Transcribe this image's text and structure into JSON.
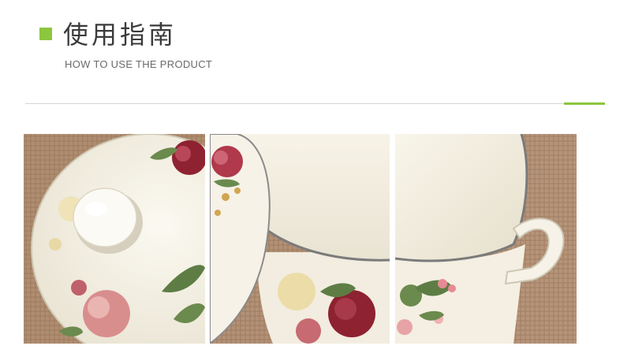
{
  "header": {
    "title": "使用指南",
    "subtitle": "HOW TO USE THE PRODUCT"
  },
  "colors": {
    "accent": "#8cc63f",
    "burlap": "#b8977a",
    "enamel": "#f3efe3",
    "rose": "#8e2231"
  },
  "photos": [
    {
      "name": "lid-closeup"
    },
    {
      "name": "pot-rim-and-lid"
    },
    {
      "name": "pot-handle"
    }
  ]
}
